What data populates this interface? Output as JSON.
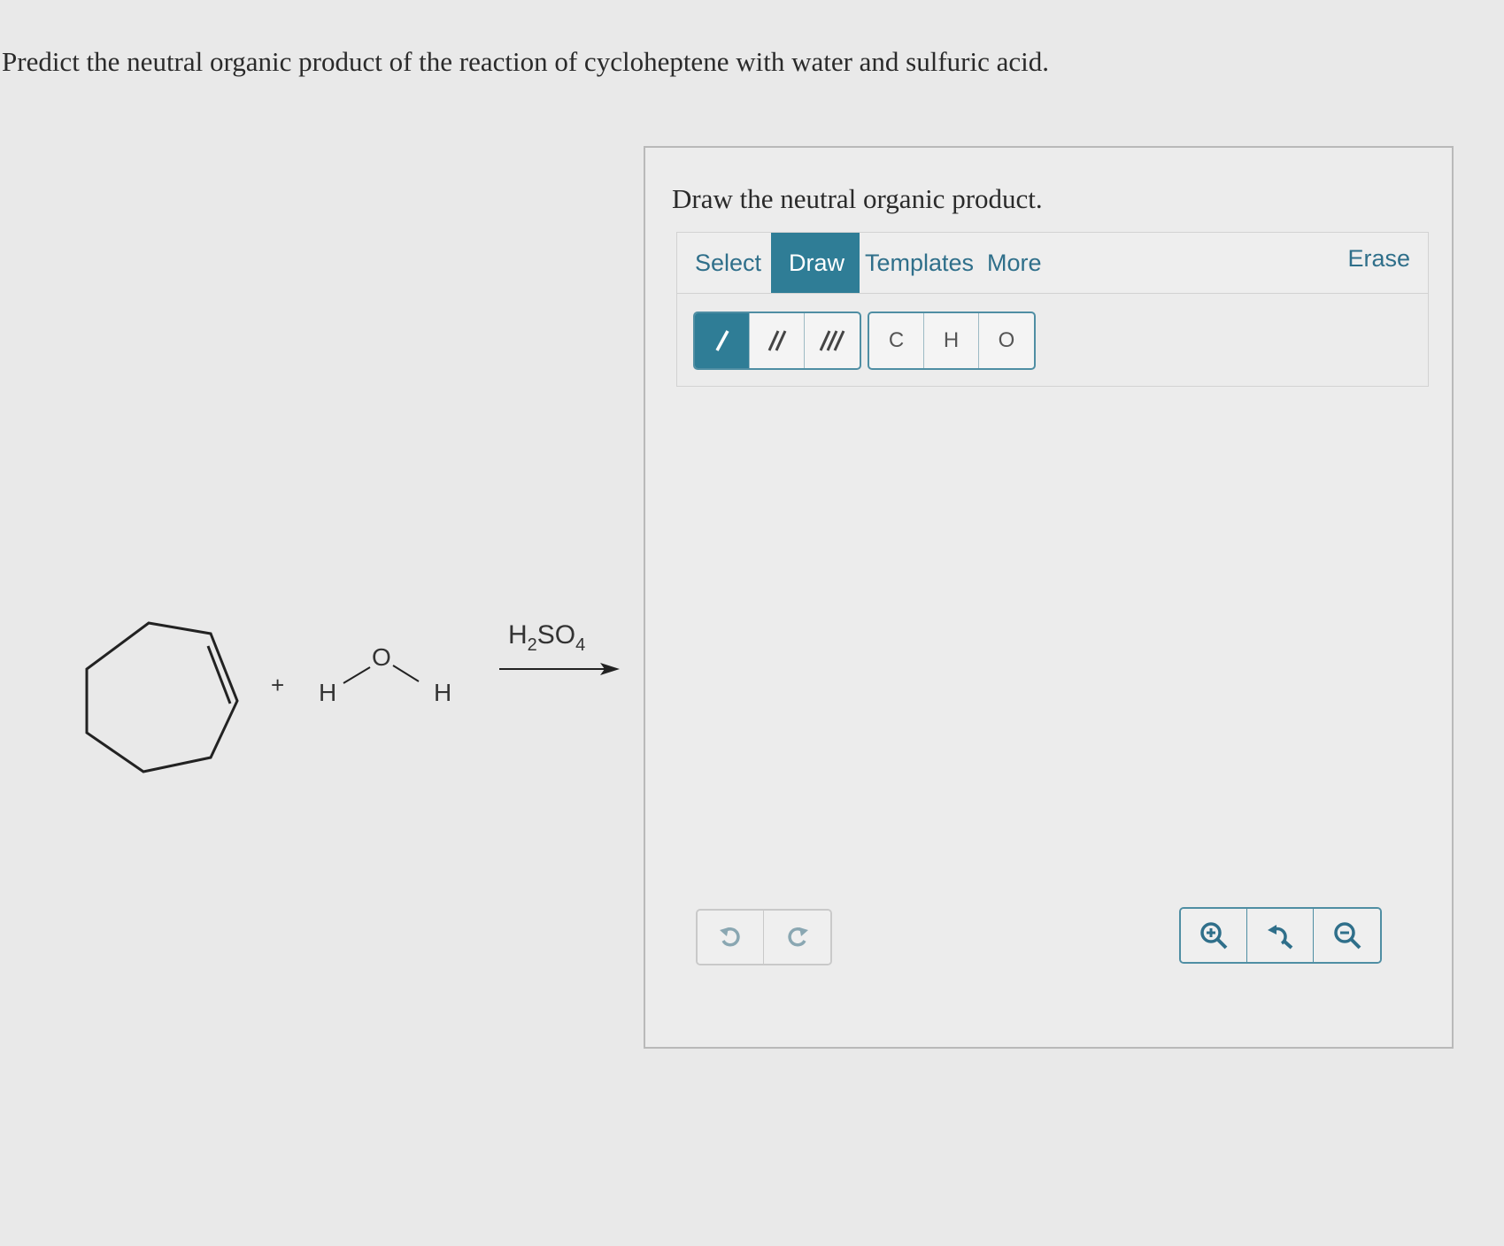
{
  "question": {
    "text": "Predict the neutral organic product of the reaction of cycloheptene with water and sulfuric acid."
  },
  "reaction": {
    "plus": "+",
    "water_h_left": "H",
    "water_o": "O",
    "water_h_right": "H",
    "reagent_main": "H",
    "reagent_sub1": "2",
    "reagent_mid": "SO",
    "reagent_sub2": "4"
  },
  "panel": {
    "prompt": "Draw the neutral organic product.",
    "menu": {
      "select": "Select",
      "draw": "Draw",
      "templates": "Templates",
      "more": "More",
      "erase": "Erase"
    },
    "atoms": [
      "C",
      "H",
      "O"
    ],
    "bond_tools": [
      "single-bond-icon",
      "double-bond-icon",
      "triple-bond-icon"
    ],
    "history_tools": [
      "undo-icon",
      "redo-icon"
    ],
    "zoom_tools": [
      "zoom-in-icon",
      "reset-zoom-icon",
      "zoom-out-icon"
    ]
  },
  "colors": {
    "accent": "#2f7d96",
    "accent_text": "#2f6f8a",
    "background": "#e9e9e9"
  }
}
